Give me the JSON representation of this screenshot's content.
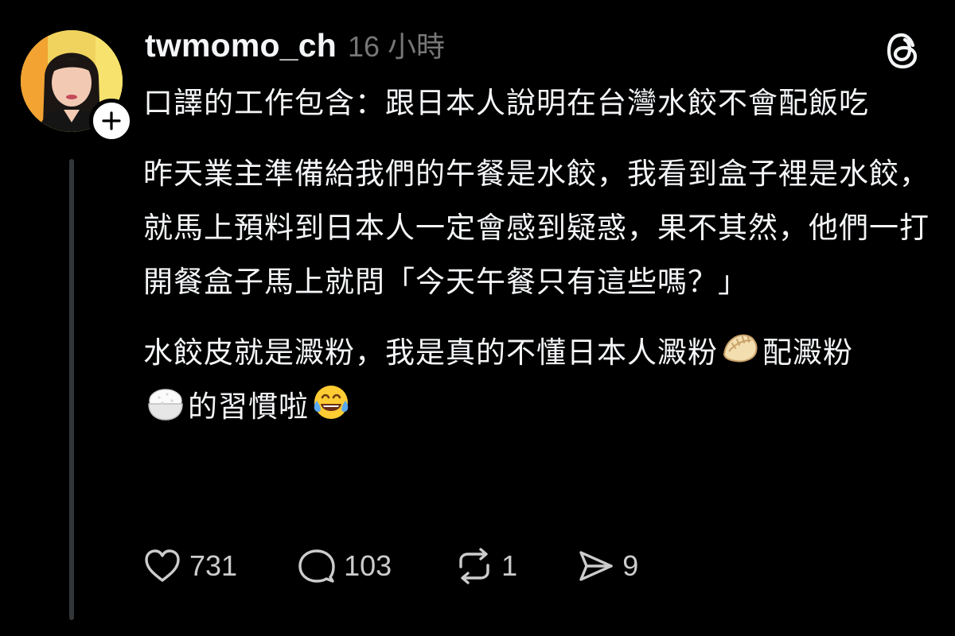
{
  "post": {
    "author": {
      "username": "twmomo_ch",
      "avatar_icon": "profile-photo"
    },
    "timestamp": "16 小時",
    "paragraphs": {
      "p1": "口譯的工作包含：跟日本人說明在台灣水餃不會配飯吃",
      "p2": "昨天業主準備給我們的午餐是水餃，我看到盒子裡是水餃，就馬上預料到日本人一定會感到疑惑，果不其然，他們一打開餐盒子馬上就問「今天午餐只有這些嗎？」",
      "p3a": "水餃皮就是澱粉，我是真的不懂日本人澱粉",
      "p3b": "配澱粉",
      "p3c": "的習慣啦"
    },
    "inline_emoji": [
      "dumpling-emoji",
      "rice-bowl-emoji",
      "tears-of-joy-emoji"
    ],
    "actions": {
      "likes": "731",
      "replies": "103",
      "reposts": "1",
      "shares": "9"
    }
  },
  "colors": {
    "background": "#000000",
    "text": "#f3f5f7",
    "muted": "#777777",
    "thread_line": "#333638"
  }
}
